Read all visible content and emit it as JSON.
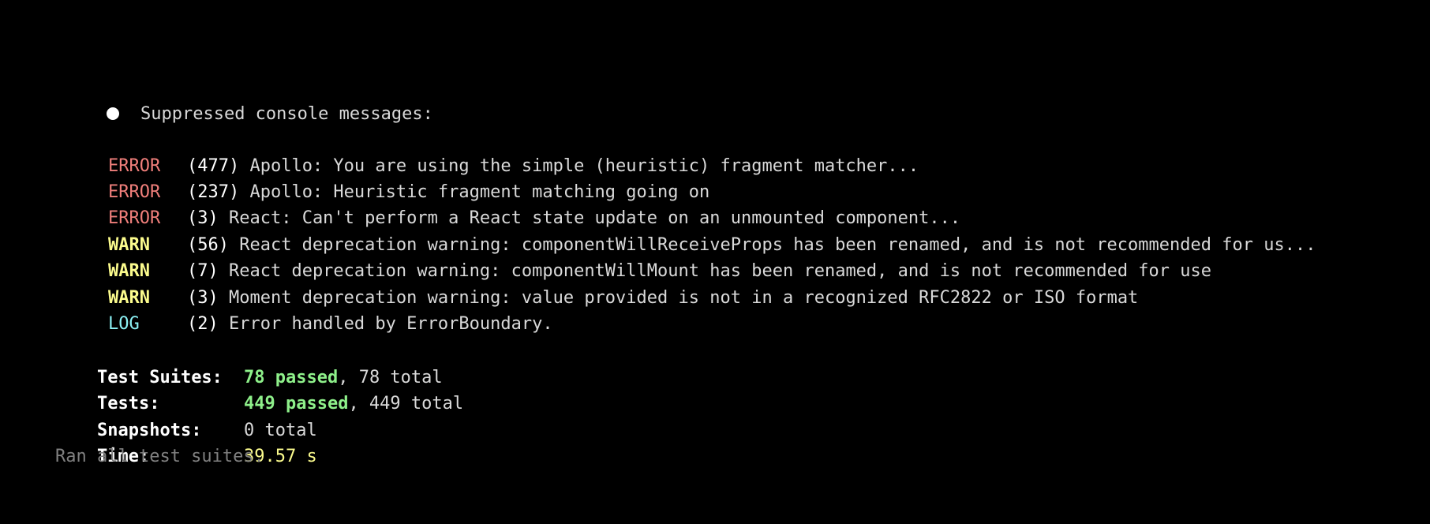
{
  "header": {
    "bullet_icon": "bullet-icon",
    "title": "Suppressed console messages:"
  },
  "messages": [
    {
      "level": "ERROR",
      "count": "(477)",
      "text": " Apollo: You are using the simple (heuristic) fragment matcher..."
    },
    {
      "level": "ERROR",
      "count": "(237)",
      "text": " Apollo: Heuristic fragment matching going on"
    },
    {
      "level": "ERROR",
      "count": "(3)",
      "text": " React: Can't perform a React state update on an unmounted component..."
    },
    {
      "level": "WARN",
      "count": "(56)",
      "text": " React deprecation warning: componentWillReceiveProps has been renamed, and is not recommended for us..."
    },
    {
      "level": "WARN",
      "count": "(7)",
      "text": " React deprecation warning: componentWillMount has been renamed, and is not recommended for use"
    },
    {
      "level": "WARN",
      "count": "(3)",
      "text": " Moment deprecation warning: value provided is not in a recognized RFC2822 or ISO format"
    },
    {
      "level": "LOG",
      "count": "(2)",
      "text": " Error handled by ErrorBoundary."
    }
  ],
  "summary": {
    "suites": {
      "label": "Test Suites:",
      "passed": "78 passed",
      "rest": ", 78 total"
    },
    "tests": {
      "label": "Tests:",
      "passed": "449 passed",
      "rest": ", 449 total"
    },
    "snapshots": {
      "label": "Snapshots:",
      "value": "0 total"
    },
    "time": {
      "label": "Time:",
      "value": "39.57 s"
    },
    "footer": "Ran all test suites."
  },
  "colors": {
    "background": "#000000",
    "error": "#f07f7b",
    "warn": "#fbfb8d",
    "log": "#8cf2f5",
    "passed": "#8ef08a",
    "dim": "#808080"
  }
}
